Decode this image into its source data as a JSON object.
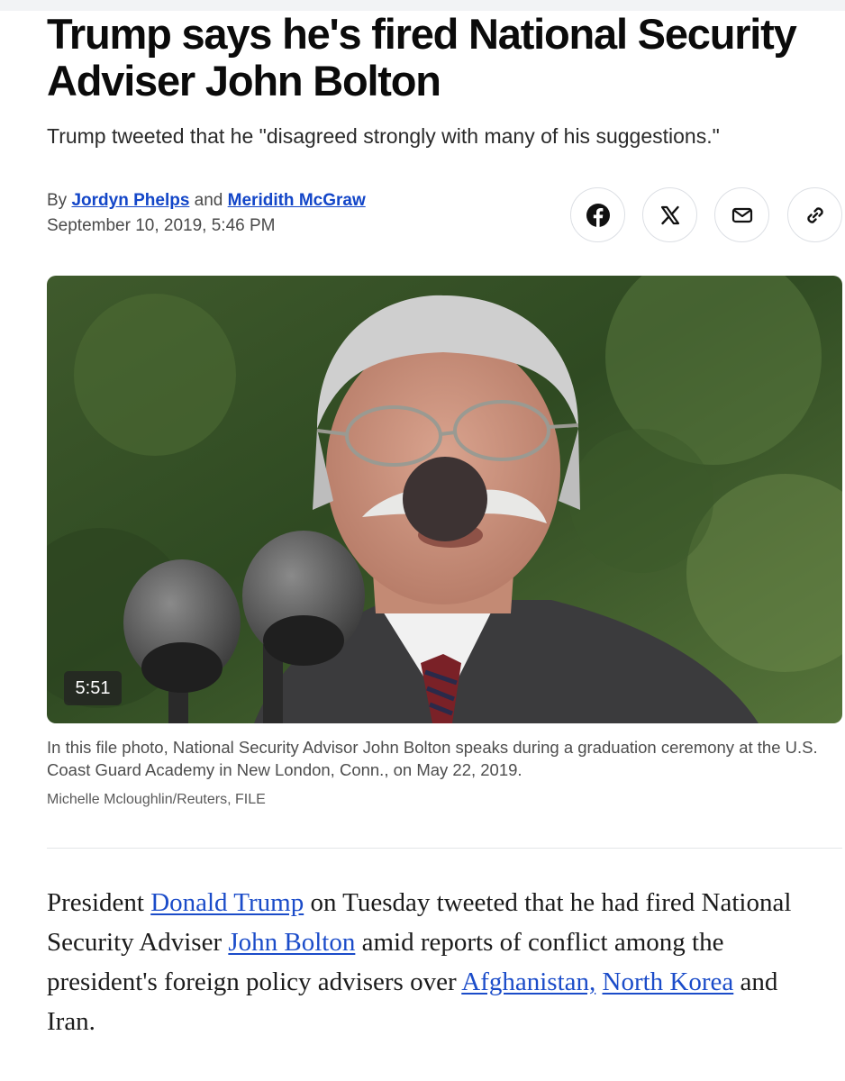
{
  "article": {
    "headline": "Trump says he's fired National Security Adviser John Bolton",
    "subheadline": "Trump tweeted that he \"disagreed strongly with many of his suggestions.\"",
    "byline": {
      "prefix": "By",
      "author1": "Jordyn Phelps",
      "joiner": "and",
      "author2": "Meridith McGraw"
    },
    "timestamp": "September 10, 2019, 5:46 PM",
    "share": {
      "icons": [
        "facebook-icon",
        "x-icon",
        "mail-icon",
        "link-icon"
      ]
    },
    "media": {
      "duration": "5:51",
      "caption": "In this file photo, National Security Advisor John Bolton speaks during a graduation ceremony at the U.S. Coast Guard Academy in New London, Conn., on May 22, 2019.",
      "credit": "Michelle Mcloughlin/Reuters, FILE"
    },
    "body": {
      "t1": "President ",
      "link1": "Donald Trump",
      "t2": " on Tuesday tweeted that he had fired National Security Adviser ",
      "link2": "John Bolton",
      "t3": " amid reports of conflict among the president's foreign policy advisers over ",
      "link3": "Afghanistan,",
      "t4": " ",
      "link4": "North Korea",
      "t5": " and Iran."
    }
  },
  "colors": {
    "link": "#1b4cc9",
    "byline_link": "#1346c8",
    "text": "#111111"
  }
}
